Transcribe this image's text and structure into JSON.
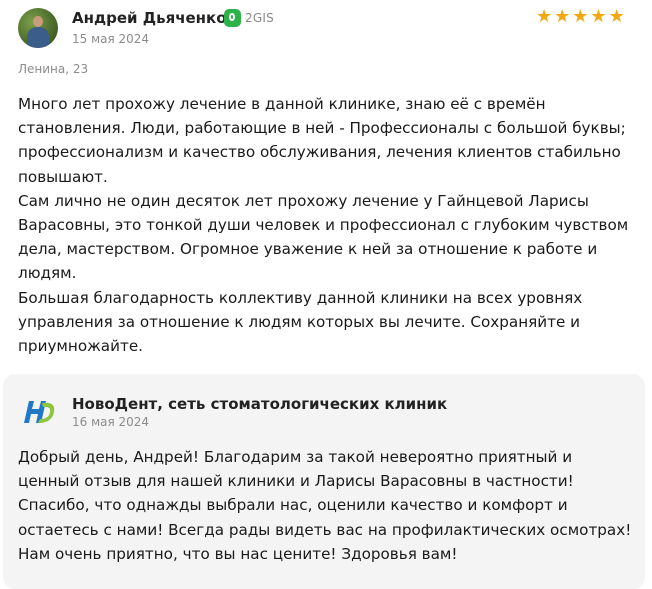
{
  "review": {
    "author": "Андрей Дьяченко",
    "source": "2GIS",
    "date": "15 мая 2024",
    "rating": 5,
    "stars": [
      "★",
      "★",
      "★",
      "★",
      "★"
    ],
    "address": "Ленина, 23",
    "text": "Много лет прохожу лечение в данной клинике, знаю её с времён\nстановления. Люди, работающие в ней - Профессионалы с большой буквы;\nпрофессионализм и качество обслуживания, лечения клиентов стабильно\nповышают.\nСам лично не один десяток лет прохожу лечение у Гайнцевой Ларисы\nВарасовны, это тонкой души человек и профессионал с глубоким чувством\nдела, мастерством. Огромное уважение к ней за отношение к работе и\nлюдям.\nБольшая благодарность коллективу данной клиники на всех уровнях\nуправления за отношение к людям которых вы лечите. Сохраняйте и\nприумножайте."
  },
  "reply": {
    "org": "НовоДент, сеть стоматологических клиник",
    "date": "16 мая 2024",
    "text": "Добрый день, Андрей! Благодарим за такой невероятно приятный и ценный отзыв для нашей клиники и Ларисы Варасовны в частности! Спасибо, что однажды выбрали нас, оценили качество и комфорт и остаетесь с нами! Всегда рады видеть вас на профилактических осмотрах! Нам очень приятно, что вы нас цените! Здоровья вам!"
  },
  "colors": {
    "star": "#f2a811",
    "source_icon": "#2db24a",
    "reply_bg": "#f4f4f4",
    "logo_blue": "#1f78c8",
    "logo_green": "#8cc63f"
  }
}
